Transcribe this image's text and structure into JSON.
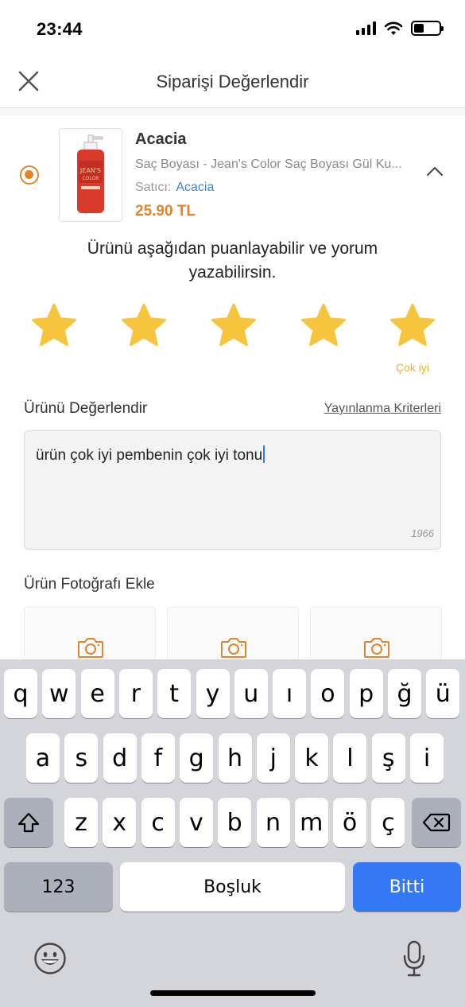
{
  "status_bar": {
    "time": "23:44",
    "battery_level": 0.4
  },
  "nav": {
    "title": "Siparişi Değerlendir",
    "close_icon": "close-icon"
  },
  "product": {
    "brand": "Acacia",
    "name": "Saç Boyası - Jean's Color Saç Boyası Gül Ku...",
    "seller_label": "Satıcı:",
    "seller_name": "Acacia",
    "price": "25.90 TL",
    "selected": true
  },
  "rating": {
    "prompt": "Ürünü aşağıdan puanlayabilir ve yorum yazabilirsin.",
    "value": 5,
    "max": 5,
    "label": "Çok iyi"
  },
  "review": {
    "title": "Ürünü Değerlendir",
    "criteria_link": "Yayınlanma Kriterleri",
    "text": "ürün çok iyi pembenin çok iyi tonu",
    "char_count": "1966"
  },
  "photos": {
    "title": "Ürün Fotoğrafı Ekle",
    "slots": 3,
    "icon": "camera-icon"
  },
  "keyboard": {
    "row1": [
      "q",
      "w",
      "e",
      "r",
      "t",
      "y",
      "u",
      "ı",
      "o",
      "p",
      "ğ",
      "ü"
    ],
    "row2": [
      "a",
      "s",
      "d",
      "f",
      "g",
      "h",
      "j",
      "k",
      "l",
      "ş",
      "i"
    ],
    "row3": [
      "z",
      "x",
      "c",
      "v",
      "b",
      "n",
      "m",
      "ö",
      "ç"
    ],
    "numbers_key": "123",
    "space_key": "Boşluk",
    "done_key": "Bitti"
  },
  "colors": {
    "accent": "#e0852e",
    "star": "#f7c43d",
    "link": "#3f86c6",
    "keyboard_done": "#3478f6"
  }
}
